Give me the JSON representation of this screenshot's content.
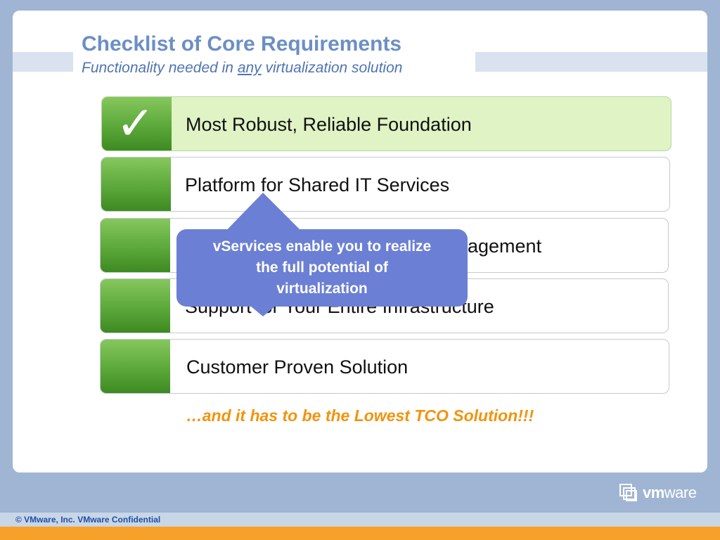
{
  "slide": {
    "title": "Checklist of Core Requirements",
    "subtitle_before": "Functionality needed in ",
    "subtitle_emphasis": "any",
    "subtitle_after": " virtualization solution"
  },
  "checklist": [
    {
      "label": "Most Robust, Reliable Foundation",
      "checked": true
    },
    {
      "label": "Platform for Shared IT Services",
      "checked": false
    },
    {
      "label": "agement",
      "checked": false
    },
    {
      "label": "Support for Your Entire Infrastructure",
      "checked": false
    },
    {
      "label": "Customer Proven Solution",
      "checked": false
    }
  ],
  "callout": {
    "text": "vServices enable you to realize the full potential of virtualization"
  },
  "tagline": "…and it has to be the Lowest TCO Solution!!!",
  "footer": {
    "copyright": "© VMware, Inc. VMware Confidential"
  },
  "logo": {
    "text_bold": "vm",
    "text_regular": "ware"
  },
  "colors": {
    "accent_green": "#5ca83a",
    "callout_blue": "#6b7fd4",
    "tagline_orange": "#f2930d",
    "title_blue": "#6b8fc4"
  },
  "icons": {
    "check": "check-mark-icon",
    "logo": "vmware-logo-icon"
  }
}
